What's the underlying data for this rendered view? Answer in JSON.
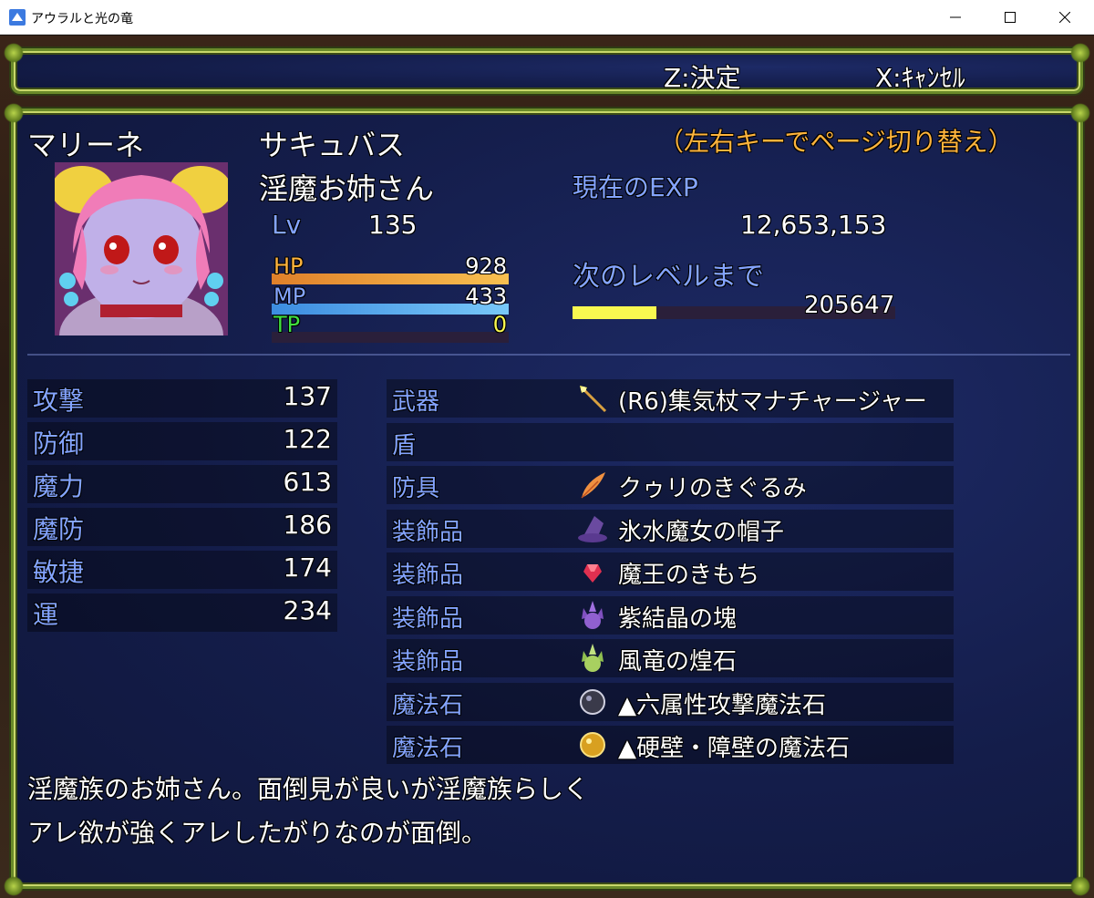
{
  "window": {
    "title": "アウラルと光の竜"
  },
  "help": {
    "confirm": "Z:決定",
    "cancel": "X:ｷｬﾝｾﾙ"
  },
  "actor": {
    "name": "マリーネ",
    "class": "サキュバス",
    "nickname": "淫魔お姉さん",
    "level_label": "Lv",
    "level": "135",
    "page_hint": "（左右キーでページ切り替え）",
    "exp_label": "現在のEXP",
    "exp": "12,653,153",
    "next_label": "次のレベルまで",
    "next_exp": "205647",
    "next_progress": 0.26,
    "hp_label": "HP",
    "hp": "928",
    "mp_label": "MP",
    "mp": "433",
    "tp_label": "TP",
    "tp": "0",
    "hp_fill": 1.0,
    "mp_fill": 1.0,
    "tp_fill": 0.0
  },
  "params": [
    {
      "name": "攻撃",
      "value": "137"
    },
    {
      "name": "防御",
      "value": "122"
    },
    {
      "name": "魔力",
      "value": "613"
    },
    {
      "name": "魔防",
      "value": "186"
    },
    {
      "name": "敏捷",
      "value": "174"
    },
    {
      "name": "運",
      "value": "234"
    }
  ],
  "equips": [
    {
      "slot": "武器",
      "item": "(R6)集気杖マナチャージャー",
      "icon": "staff-icon"
    },
    {
      "slot": "盾",
      "item": "",
      "icon": ""
    },
    {
      "slot": "防具",
      "item": "クゥリのきぐるみ",
      "icon": "feather-icon"
    },
    {
      "slot": "装飾品",
      "item": "氷水魔女の帽子",
      "icon": "witch-hat-icon"
    },
    {
      "slot": "装飾品",
      "item": "魔王のきもち",
      "icon": "red-gem-icon"
    },
    {
      "slot": "装飾品",
      "item": "紫結晶の塊",
      "icon": "purple-crystal-icon"
    },
    {
      "slot": "装飾品",
      "item": "風竜の煌石",
      "icon": "green-crystal-icon"
    },
    {
      "slot": "魔法石",
      "item": "▲六属性攻撃魔法石",
      "icon": "dark-orb-icon"
    },
    {
      "slot": "魔法石",
      "item": "▲硬壁・障壁の魔法石",
      "icon": "gold-orb-icon"
    }
  ],
  "description": {
    "line1": "淫魔族のお姉さん。面倒見が良いが淫魔族らしく",
    "line2": "アレ欲が強くアレしたがりなのが面倒。"
  },
  "colors": {
    "hp_gauge": [
      "#e0802a",
      "#f8c050"
    ],
    "mp_gauge": [
      "#3c8ce0",
      "#78c8f8"
    ],
    "exp_gauge": "#f8f850",
    "system_text": "#84a4ff",
    "hint_text": "#ffb43c"
  }
}
